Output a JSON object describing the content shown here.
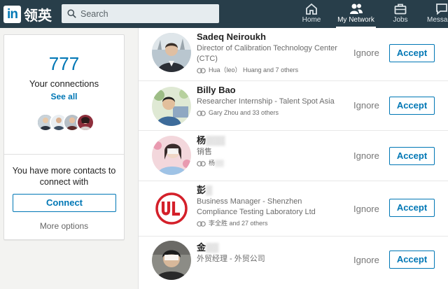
{
  "header": {
    "logo_in": "in",
    "logo_text": "领英",
    "search_placeholder": "Search",
    "nav": [
      {
        "label": "Home",
        "icon": "home-icon"
      },
      {
        "label": "My Network",
        "icon": "my-network-icon",
        "active": true
      },
      {
        "label": "Jobs",
        "icon": "briefcase-icon"
      },
      {
        "label": "Messa",
        "icon": "messaging-icon"
      }
    ]
  },
  "sidebar": {
    "connection_count": "777",
    "connections_label": "Your connections",
    "see_all": "See all",
    "more_contacts_text": "You have more contacts to connect with",
    "connect_label": "Connect",
    "more_options": "More options"
  },
  "invitations": [
    {
      "name": "Sadeq Neiroukh",
      "title": "Director of Calibration Technology Center (CTC)",
      "mutual": "Hua（leo） Huang and 7 others",
      "ignore": "Ignore",
      "accept": "Accept"
    },
    {
      "name": "Billy Bao",
      "title": "Researcher Internship - Talent Spot Asia",
      "mutual": "Gary Zhou and 33 others",
      "ignore": "Ignore",
      "accept": "Accept"
    },
    {
      "name": "杨",
      "title": "销售",
      "mutual": "杨",
      "ignore": "Ignore",
      "accept": "Accept"
    },
    {
      "name": "彭",
      "title": "Business Manager - Shenzhen Compliance Testing Laboratory Ltd",
      "mutual": "李全胜 and 27 others",
      "ignore": "Ignore",
      "accept": "Accept"
    },
    {
      "name": "金",
      "title": "外贸经理 - 外贸公司",
      "mutual": "",
      "ignore": "Ignore",
      "accept": "Accept"
    }
  ],
  "colors": {
    "topbar": "#283e4a",
    "accent": "#0077b5",
    "ul_logo_red": "#d4202a"
  }
}
